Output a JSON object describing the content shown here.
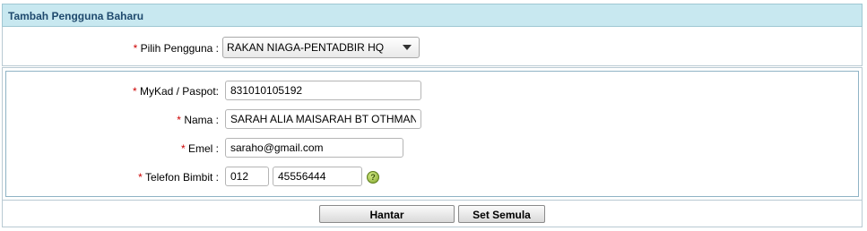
{
  "header": {
    "title": "Tambah Pengguna Baharu"
  },
  "form": {
    "required_mark": "*",
    "user_type": {
      "label": "Pilih Pengguna :",
      "value": "RAKAN NIAGA-PENTADBIR HQ"
    },
    "mykad": {
      "label": "MyKad / Paspot:",
      "value": "831010105192"
    },
    "nama": {
      "label": "Nama :",
      "value": "SARAH ALIA MAISARAH BT OTHMAN"
    },
    "emel": {
      "label": "Emel :",
      "value": "saraho@gmail.com"
    },
    "telefon": {
      "label": "Telefon Bimbit :",
      "prefix": "012",
      "number": "45556444"
    },
    "help_icon": "help-icon"
  },
  "actions": {
    "submit_label": "Hantar",
    "reset_label": "Set Semula"
  }
}
